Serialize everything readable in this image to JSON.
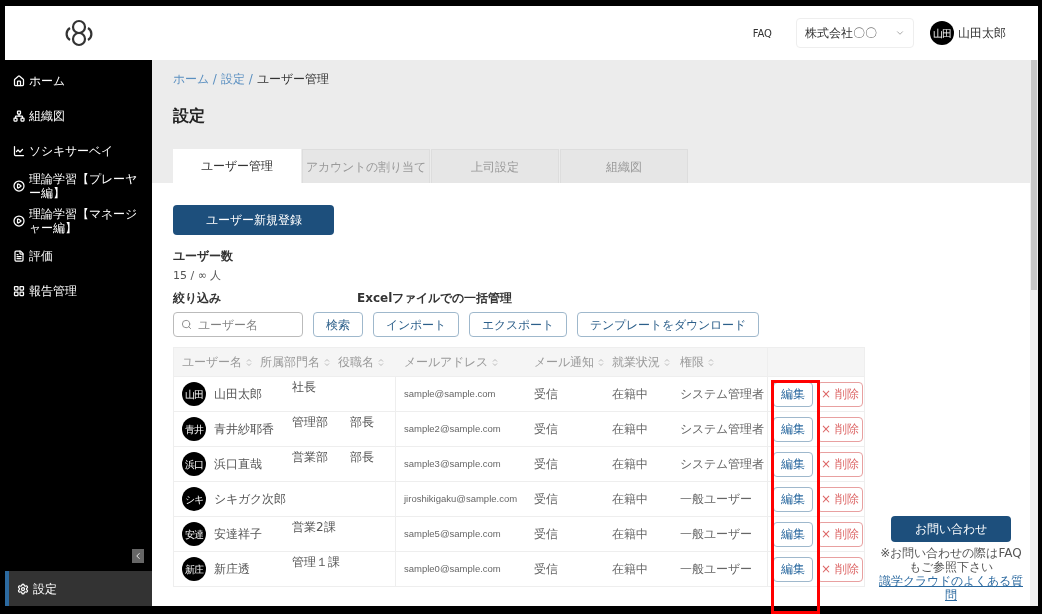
{
  "header": {
    "faq": "FAQ",
    "company": "株式会社〇〇",
    "user": {
      "avatar": "山田",
      "name": "山田太郎"
    }
  },
  "sidebar": {
    "items": [
      {
        "label": "ホーム",
        "kind": "home",
        "selected": false
      },
      {
        "label": "組織図",
        "kind": "org",
        "selected": false
      },
      {
        "label": "ソシキサーベイ",
        "kind": "chart",
        "selected": false
      },
      {
        "label": "理論学習【プレーヤー編】",
        "kind": "play",
        "selected": false
      },
      {
        "label": "理論学習【マネージャー編】",
        "kind": "play",
        "selected": false
      },
      {
        "label": "評価",
        "kind": "doc",
        "selected": false
      },
      {
        "label": "報告管理",
        "kind": "grid",
        "selected": false
      }
    ],
    "bottom_item": {
      "label": "設定",
      "kind": "gear",
      "selected": true
    }
  },
  "breadcrumb": [
    {
      "label": "ホーム /",
      "link": true
    },
    {
      "label": "設定 /",
      "link": true
    },
    {
      "label": "ユーザー管理",
      "link": false
    }
  ],
  "page_title": "設定",
  "tabs": [
    {
      "label": "ユーザー管理",
      "selected": true
    },
    {
      "label": "アカウントの割り当て",
      "selected": false
    },
    {
      "label": "上司設定",
      "selected": false
    },
    {
      "label": "組織図",
      "selected": false
    }
  ],
  "register_button": "ユーザー新規登録",
  "user_count": {
    "label": "ユーザー数",
    "value": "15 / ∞ 人"
  },
  "filter": {
    "label": "絞り込み",
    "placeholder": "ユーザー名",
    "search_button": "検索"
  },
  "excel": {
    "label": "Excelファイルでの一括管理",
    "buttons": [
      "インポート",
      "エクスポート",
      "テンプレートをダウンロード"
    ]
  },
  "table": {
    "columns": [
      "ユーザー名",
      "所属部門名",
      "役職名",
      "メールアドレス",
      "メール通知",
      "就業状況",
      "権限"
    ],
    "rows": [
      {
        "avatar": "山田",
        "name": "山田太郎",
        "department": "社長",
        "position": "",
        "email": "sample@sample.com",
        "notification": "受信",
        "status": "在籍中",
        "role": "システム管理者",
        "edit": "編集",
        "delete": "× 削除"
      },
      {
        "avatar": "青井",
        "name": "青井紗耶香",
        "department": "管理部",
        "position": "部長",
        "email": "sample2@sample.com",
        "notification": "受信",
        "status": "在籍中",
        "role": "システム管理者",
        "edit": "編集",
        "delete": "× 削除"
      },
      {
        "avatar": "浜口",
        "name": "浜口直哉",
        "department": "営業部",
        "position": "部長",
        "email": "sample3@sample.com",
        "notification": "受信",
        "status": "在籍中",
        "role": "システム管理者",
        "edit": "編集",
        "delete": "× 削除"
      },
      {
        "avatar": "シキ",
        "name": "シキガク次郎",
        "department": "",
        "position": "",
        "email": "jiroshikigaku@sample.com",
        "notification": "受信",
        "status": "在籍中",
        "role": "一般ユーザー",
        "edit": "編集",
        "delete": "× 削除"
      },
      {
        "avatar": "安達",
        "name": "安達祥子",
        "department": "営業2課",
        "position": "",
        "email": "sample5@sample.com",
        "notification": "受信",
        "status": "在籍中",
        "role": "一般ユーザー",
        "edit": "編集",
        "delete": "× 削除"
      },
      {
        "avatar": "新庄",
        "name": "新庄透",
        "department": "管理１課",
        "position": "",
        "email": "sample0@sample.com",
        "notification": "受信",
        "status": "在籍中",
        "role": "一般ユーザー",
        "edit": "編集",
        "delete": "× 削除"
      }
    ]
  },
  "highlight": {
    "on": true
  },
  "contact": {
    "button": "お問い合わせ",
    "note": "※お問い合わせの際はFAQもご参照下さい",
    "link": "識学クラウドのよくある質問"
  }
}
